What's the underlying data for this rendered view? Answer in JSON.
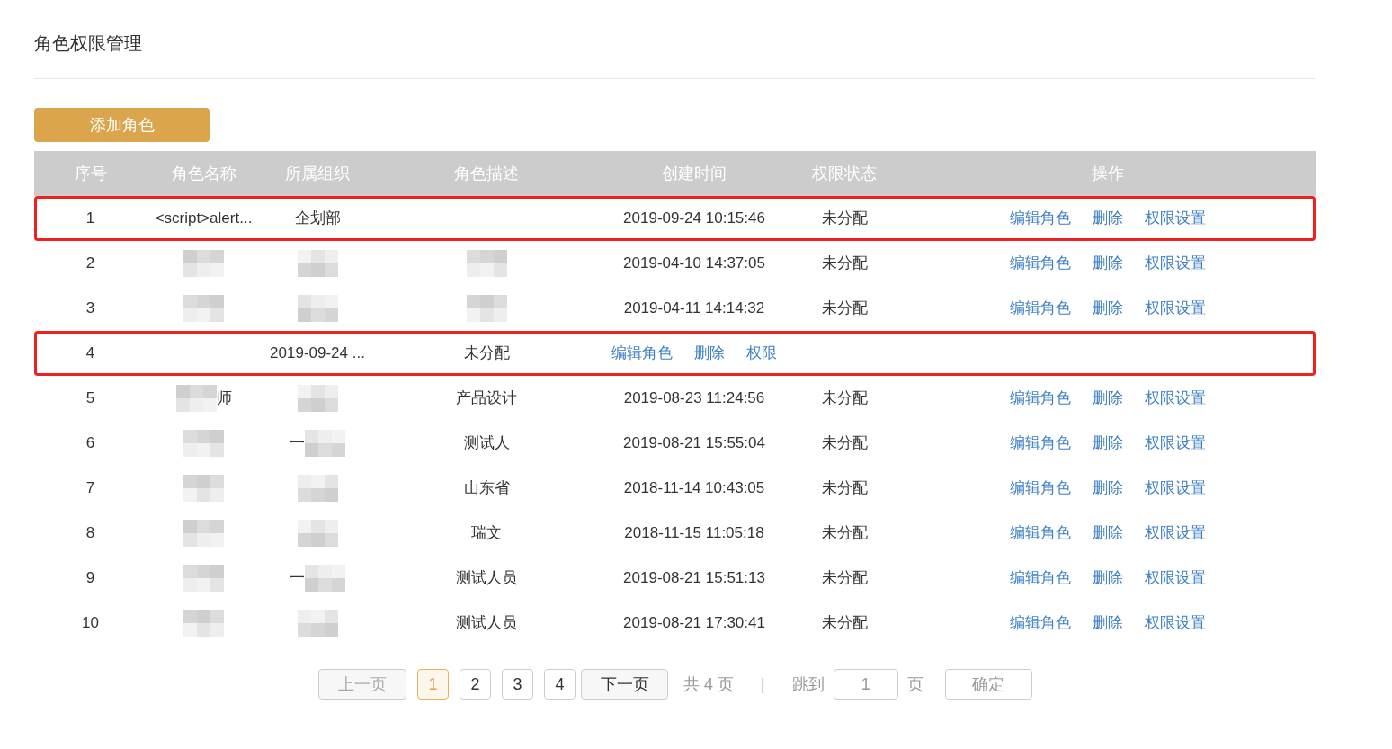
{
  "page": {
    "title": "角色权限管理"
  },
  "add_button": {
    "label": "添加角色"
  },
  "table": {
    "columns": [
      "序号",
      "角色名称",
      "所属组织",
      "角色描述",
      "创建时间",
      "权限状态",
      "操作"
    ],
    "rows": [
      {
        "highlighted": true,
        "cells": [
          {
            "text": "1"
          },
          {
            "text": "<script>alert..."
          },
          {
            "text": "企划部"
          },
          {},
          {
            "text": "2019-09-24 10:15:46"
          },
          {
            "text": "未分配"
          },
          {
            "actions": [
              "编辑角色",
              "删除",
              "权限设置"
            ]
          }
        ]
      },
      {
        "highlighted": false,
        "cells": [
          {
            "text": "2"
          },
          {
            "redacted": true
          },
          {
            "redacted": true
          },
          {
            "redacted": true
          },
          {
            "text": "2019-04-10 14:37:05"
          },
          {
            "text": "未分配"
          },
          {
            "actions": [
              "编辑角色",
              "删除",
              "权限设置"
            ]
          }
        ]
      },
      {
        "highlighted": false,
        "cells": [
          {
            "text": "3"
          },
          {
            "redacted": true
          },
          {
            "redacted": true
          },
          {
            "redacted": true
          },
          {
            "text": "2019-04-11 14:14:32"
          },
          {
            "text": "未分配"
          },
          {
            "actions": [
              "编辑角色",
              "删除",
              "权限设置"
            ]
          }
        ]
      },
      {
        "highlighted": true,
        "cells": [
          {
            "text": "4"
          },
          {},
          {
            "text": "2019-09-24 ..."
          },
          {
            "text": "未分配"
          },
          {
            "actions": [
              "编辑角色",
              "删除",
              "权限"
            ]
          },
          {},
          {}
        ]
      },
      {
        "highlighted": false,
        "cells": [
          {
            "text": "5"
          },
          {
            "redacted": true,
            "tail": "师"
          },
          {
            "redacted": true
          },
          {
            "text": "产品设计"
          },
          {
            "text": "2019-08-23 11:24:56"
          },
          {
            "text": "未分配"
          },
          {
            "actions": [
              "编辑角色",
              "删除",
              "权限设置"
            ]
          }
        ]
      },
      {
        "highlighted": false,
        "cells": [
          {
            "text": "6"
          },
          {
            "redacted": true
          },
          {
            "redacted": true,
            "lead": "一"
          },
          {
            "text": "测试人"
          },
          {
            "text": "2019-08-21 15:55:04"
          },
          {
            "text": "未分配"
          },
          {
            "actions": [
              "编辑角色",
              "删除",
              "权限设置"
            ]
          }
        ]
      },
      {
        "highlighted": false,
        "cells": [
          {
            "text": "7"
          },
          {
            "redacted": true
          },
          {
            "redacted": true
          },
          {
            "text": "山东省"
          },
          {
            "text": "2018-11-14 10:43:05"
          },
          {
            "text": "未分配"
          },
          {
            "actions": [
              "编辑角色",
              "删除",
              "权限设置"
            ]
          }
        ]
      },
      {
        "highlighted": false,
        "cells": [
          {
            "text": "8"
          },
          {
            "redacted": true
          },
          {
            "redacted": true
          },
          {
            "text": "瑞文"
          },
          {
            "text": "2018-11-15 11:05:18"
          },
          {
            "text": "未分配"
          },
          {
            "actions": [
              "编辑角色",
              "删除",
              "权限设置"
            ]
          }
        ]
      },
      {
        "highlighted": false,
        "cells": [
          {
            "text": "9"
          },
          {
            "redacted": true
          },
          {
            "redacted": true,
            "lead": "一"
          },
          {
            "text": "测试人员"
          },
          {
            "text": "2019-08-21 15:51:13"
          },
          {
            "text": "未分配"
          },
          {
            "actions": [
              "编辑角色",
              "删除",
              "权限设置"
            ]
          }
        ]
      },
      {
        "highlighted": false,
        "cells": [
          {
            "text": "10"
          },
          {
            "redacted": true
          },
          {
            "redacted": true
          },
          {
            "text": "测试人员"
          },
          {
            "text": "2019-08-21 17:30:41"
          },
          {
            "text": "未分配"
          },
          {
            "actions": [
              "编辑角色",
              "删除",
              "权限设置"
            ]
          }
        ]
      }
    ]
  },
  "pagination": {
    "prev": {
      "label": "上一页",
      "disabled": true
    },
    "pages": [
      {
        "label": "1",
        "selected": true
      },
      {
        "label": "2",
        "selected": false
      },
      {
        "label": "3",
        "selected": false
      },
      {
        "label": "4",
        "selected": false
      }
    ],
    "next": {
      "label": "下一页",
      "disabled": false
    },
    "total": "共 4 页",
    "separator": "|",
    "jump_label": "跳到",
    "jump_value": "1",
    "page_unit": "页",
    "confirm": "确定"
  }
}
